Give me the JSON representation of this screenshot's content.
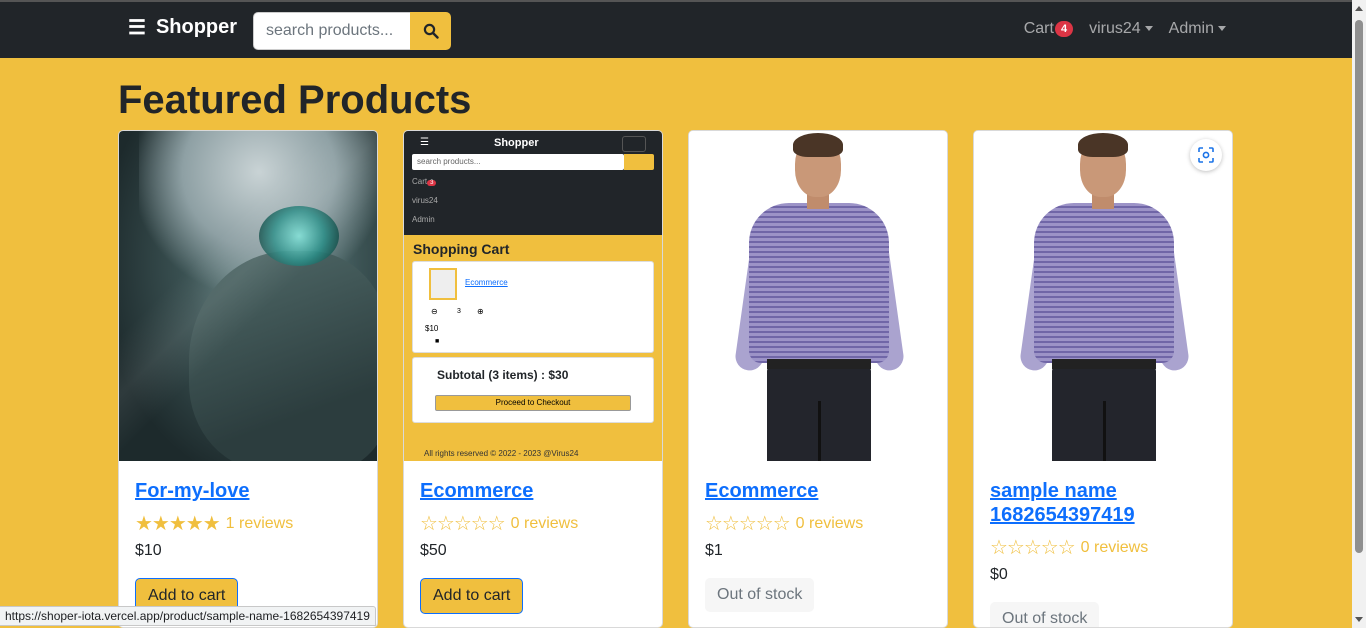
{
  "nav": {
    "brand": "Shopper",
    "search_placeholder": "search products...",
    "cart_label": "Cart",
    "cart_count": "4",
    "user_label": "virus24",
    "admin_label": "Admin"
  },
  "page_title": "Featured Products",
  "products": [
    {
      "name": "For-my-love",
      "stars": "★★★★★",
      "reviews": "1 reviews",
      "rating": 5,
      "price": "$10",
      "action": "Add to cart",
      "image": "anime-art"
    },
    {
      "name": "Ecommerce",
      "stars": "☆☆☆☆☆",
      "reviews": "0 reviews",
      "rating": 0,
      "price": "$50",
      "action": "Add to cart",
      "image": "shopper-screenshot"
    },
    {
      "name": "Ecommerce",
      "stars": "☆☆☆☆☆",
      "reviews": "0 reviews",
      "rating": 0,
      "price": "$1",
      "action": "Out of stock",
      "image": "shirt-model"
    },
    {
      "name": "sample name 1682654397419",
      "stars": "☆☆☆☆☆",
      "reviews": "0 reviews",
      "rating": 0,
      "price": "$0",
      "action": "Out of stock",
      "image": "shirt-model"
    }
  ],
  "mini_screenshot": {
    "brand": "Shopper",
    "search": "search products...",
    "cart": "Cart",
    "cart_count": "3",
    "user": "virus24",
    "admin": "Admin",
    "title": "Shopping Cart",
    "item_link": "Ecommerce",
    "qty": "3",
    "item_price": "$10",
    "subtotal": "Subtotal (3 items) : $30",
    "checkout": "Proceed to Checkout",
    "footer": "All rights reserved © 2022 - 2023 @Virus24"
  },
  "status_url": "https://shoper-iota.vercel.app/product/sample-name-1682654397419",
  "colors": {
    "accent": "#f0bf3e",
    "navbar": "#212529",
    "link": "#0d6efd",
    "badge": "#dc3545"
  }
}
